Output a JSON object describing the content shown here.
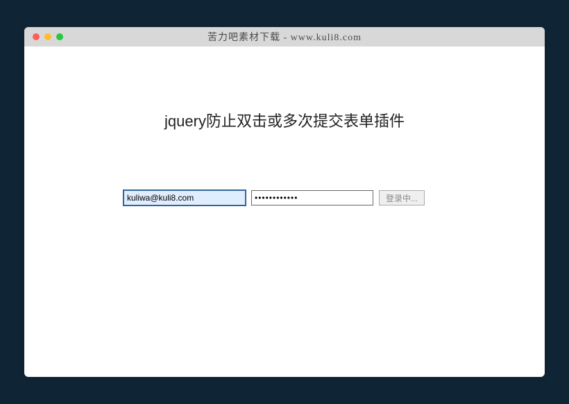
{
  "window": {
    "title": "苦力吧素材下载 - www.kuli8.com"
  },
  "page": {
    "heading": "jquery防止双击或多次提交表单插件"
  },
  "form": {
    "email_value": "kuliwa@kuli8.com",
    "password_value": "••••••••••••",
    "submit_label": "登录中..."
  }
}
